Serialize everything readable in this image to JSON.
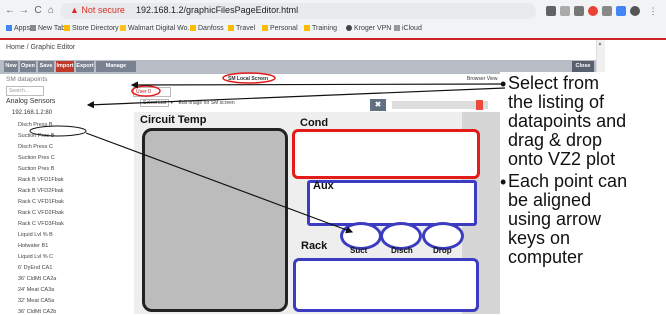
{
  "browser": {
    "nav": {
      "back": "←",
      "forward": "→",
      "reload": "C",
      "home": "⌂"
    },
    "security_label": "Not secure",
    "url": "192.168.1.2/graphicFilesPageEditor.html",
    "bookmarks": [
      "Apps",
      "New Tab",
      "Store Directory",
      "Walmart Digital Wo...",
      "Danfoss",
      "Travel",
      "Personal",
      "Training",
      "Kroger VPN",
      "iCloud"
    ]
  },
  "app": {
    "breadcrumb": "Home / Graphic Editor",
    "toolbar": {
      "buttons": [
        "New",
        "Open",
        "Save",
        "Import",
        "Export",
        "Manage graphics"
      ],
      "close": "Close"
    },
    "sidebar": {
      "title": "SM datapoints",
      "search_placeholder": "Search...",
      "section": "Analog Sensors",
      "device": "192.168.1.2:80",
      "datapoints": [
        "Disch Press B",
        "Suction Pres B",
        "Disch Press C",
        "Suction Pres C",
        "Suction Pres B",
        "Rack B VFD1Fbak",
        "Rack B VFD2Fbak",
        "Rack C VFD1Fbak",
        "Rack C VFD2Fbak",
        "Rack C VFD3Fbak",
        "Liquid Lvl % B",
        "Hotwater B1",
        "Liquid Lvl % C",
        "6' DyEnd CA1",
        "36' CldMt CA2a",
        "24' Meat CA3a",
        "32' Meat CA5a",
        "36' CldMt CA2b"
      ]
    },
    "editor": {
      "tab_active": "SM Local Screen",
      "tab_other": "Browser View",
      "user_field": "User 0",
      "select_value": "Select List",
      "edit_image_label": "Edit image for SM screen",
      "close_x": "✖",
      "slider_value_pct": 88
    },
    "plot": {
      "circuit_title": "Circuit Temp",
      "cond_title": "Cond",
      "aux_title": "Aux",
      "rack_title": "Rack",
      "suct": "Suct",
      "disch": "Disch",
      "drop": "Drop"
    },
    "version": "Version G831.002.026",
    "accent_red": "#e31b1b",
    "accent_blue": "#3c3cc2"
  },
  "annotations": {
    "bullet1": [
      "Select from",
      "the listing of",
      "datapoints and",
      "drag & drop",
      "onto VZ2 plot"
    ],
    "bullet2": [
      "Each point can",
      "be aligned",
      "using arrow",
      "keys on",
      "computer"
    ]
  }
}
